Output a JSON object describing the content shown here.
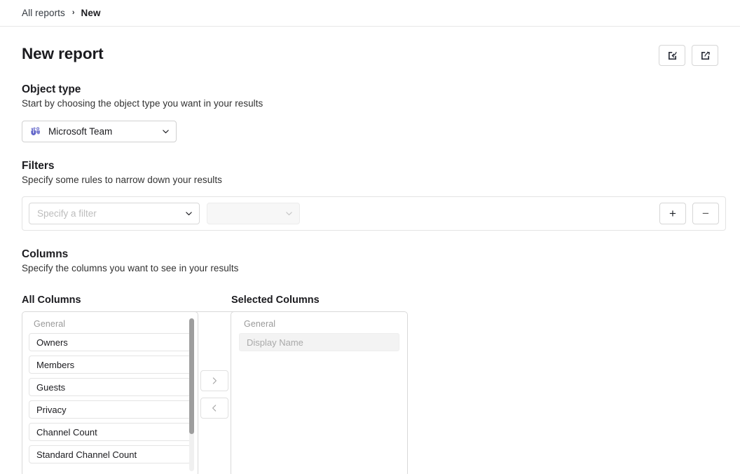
{
  "breadcrumb": {
    "parent": "All reports",
    "separator": "›",
    "current": "New"
  },
  "header": {
    "title": "New report",
    "actions": [
      {
        "name": "import-report-button",
        "icon": "import-icon",
        "label": "Import"
      },
      {
        "name": "export-report-button",
        "icon": "export-icon",
        "label": "Export"
      }
    ]
  },
  "object_type": {
    "title": "Object type",
    "subtitle": "Start by choosing the object type you want in your results",
    "selected": "Microsoft Team",
    "icon": "microsoft-teams-icon",
    "icon_color": "#5b5fc7"
  },
  "filters": {
    "title": "Filters",
    "subtitle": "Specify some rules to narrow down your results",
    "filter_placeholder": "Specify a filter",
    "filter_value": "",
    "operator_placeholder": "",
    "operator_value": "",
    "add_label": "+",
    "remove_label": "−"
  },
  "columns": {
    "title": "Columns",
    "subtitle": "Specify the columns you want to see in your results",
    "all_label": "All Columns",
    "selected_label": "Selected Columns",
    "all_group": "General",
    "all_items": [
      "Owners",
      "Members",
      "Guests",
      "Privacy",
      "Channel Count",
      "Standard Channel Count"
    ],
    "selected_group": "General",
    "selected_items": [
      "Display Name"
    ],
    "move_right_label": "›",
    "move_left_label": "‹"
  },
  "colors": {
    "accent": "#5b5fc7",
    "text": "#1b1b1f",
    "muted": "#9a9a9a",
    "border": "#d9d9d9"
  }
}
